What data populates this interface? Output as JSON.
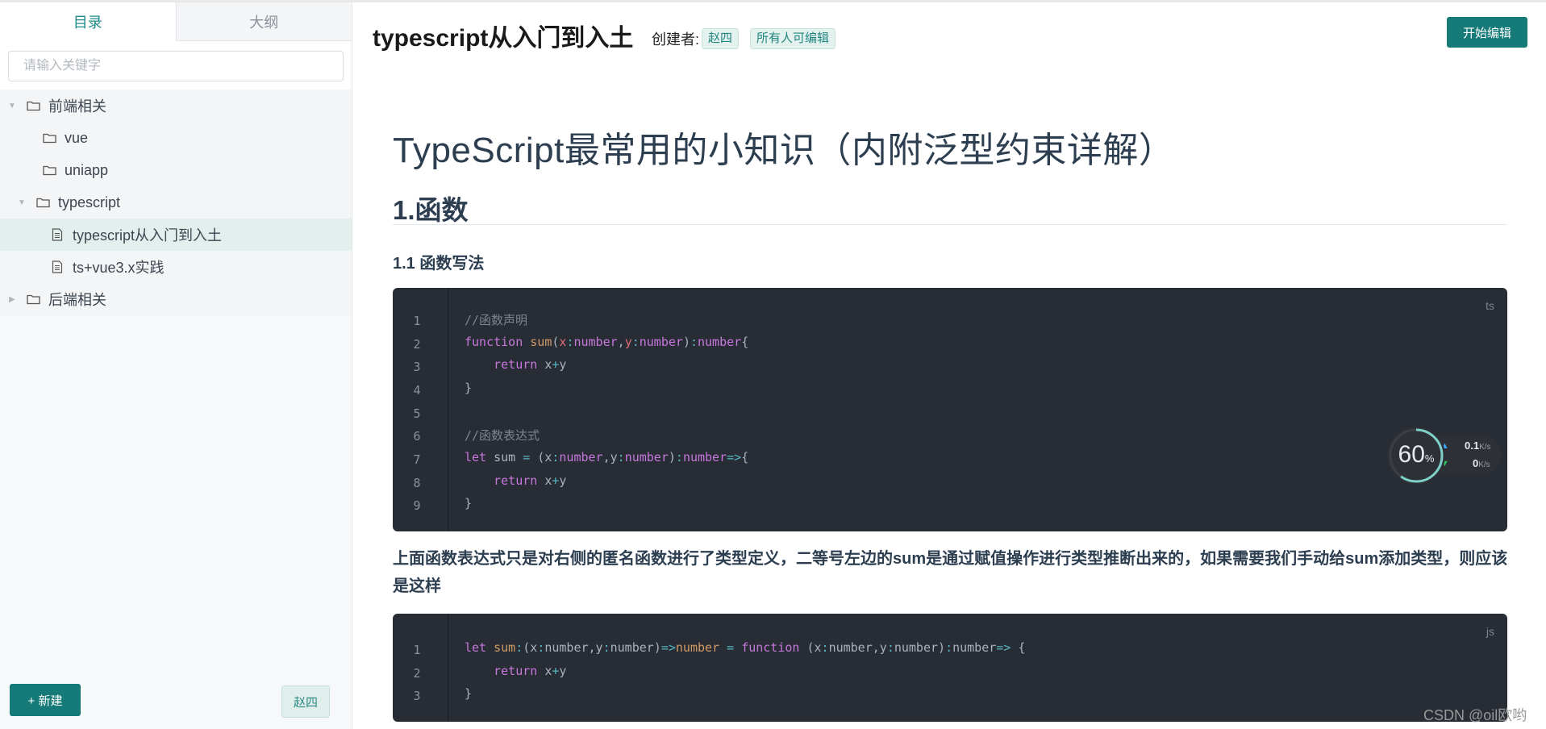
{
  "sidebar": {
    "tabs": [
      {
        "label": "目录",
        "active": true
      },
      {
        "label": "大纲",
        "active": false
      }
    ],
    "search_placeholder": "请输入关键字",
    "tree": [
      {
        "label": "前端相关",
        "type": "folder",
        "expanded": true,
        "depth": 0
      },
      {
        "label": "vue",
        "type": "folder",
        "expanded": false,
        "depth": 1
      },
      {
        "label": "uniapp",
        "type": "folder",
        "expanded": false,
        "depth": 1
      },
      {
        "label": "typescript",
        "type": "folder",
        "expanded": true,
        "depth": 1
      },
      {
        "label": "typescript从入门到入土",
        "type": "file",
        "selected": true,
        "depth": 2
      },
      {
        "label": "ts+vue3.x实践",
        "type": "file",
        "depth": 2
      },
      {
        "label": "后端相关",
        "type": "folder",
        "expanded": false,
        "depth": 0
      }
    ],
    "new_button": "+ 新建",
    "user_chip": "赵四"
  },
  "header": {
    "title": "typescript从入门到入土",
    "creator_label": "创建者:",
    "creator": "赵四",
    "permission": "所有人可编辑",
    "edit_button": "开始编辑"
  },
  "article": {
    "title": "TypeScript最常用的小知识（内附泛型约束详解）",
    "section": "1.函数",
    "subsection": "1.1 函数写法",
    "code1_lang": "ts",
    "code2_lang": "js",
    "paragraph": "上面函数表达式只是对右侧的匿名函数进行了类型定义，二等号左边的sum是通过赋值操作进行类型推断出来的，如果需要我们手动给sum添加类型，则应该是这样"
  },
  "speed_widget": {
    "percent": "60",
    "percent_unit": "%",
    "upload": "0.1",
    "download": "0",
    "unit": "K/s"
  },
  "watermark": "CSDN @oil欧哟",
  "colors": {
    "accent": "#157a78",
    "code_bg": "#282c34"
  }
}
